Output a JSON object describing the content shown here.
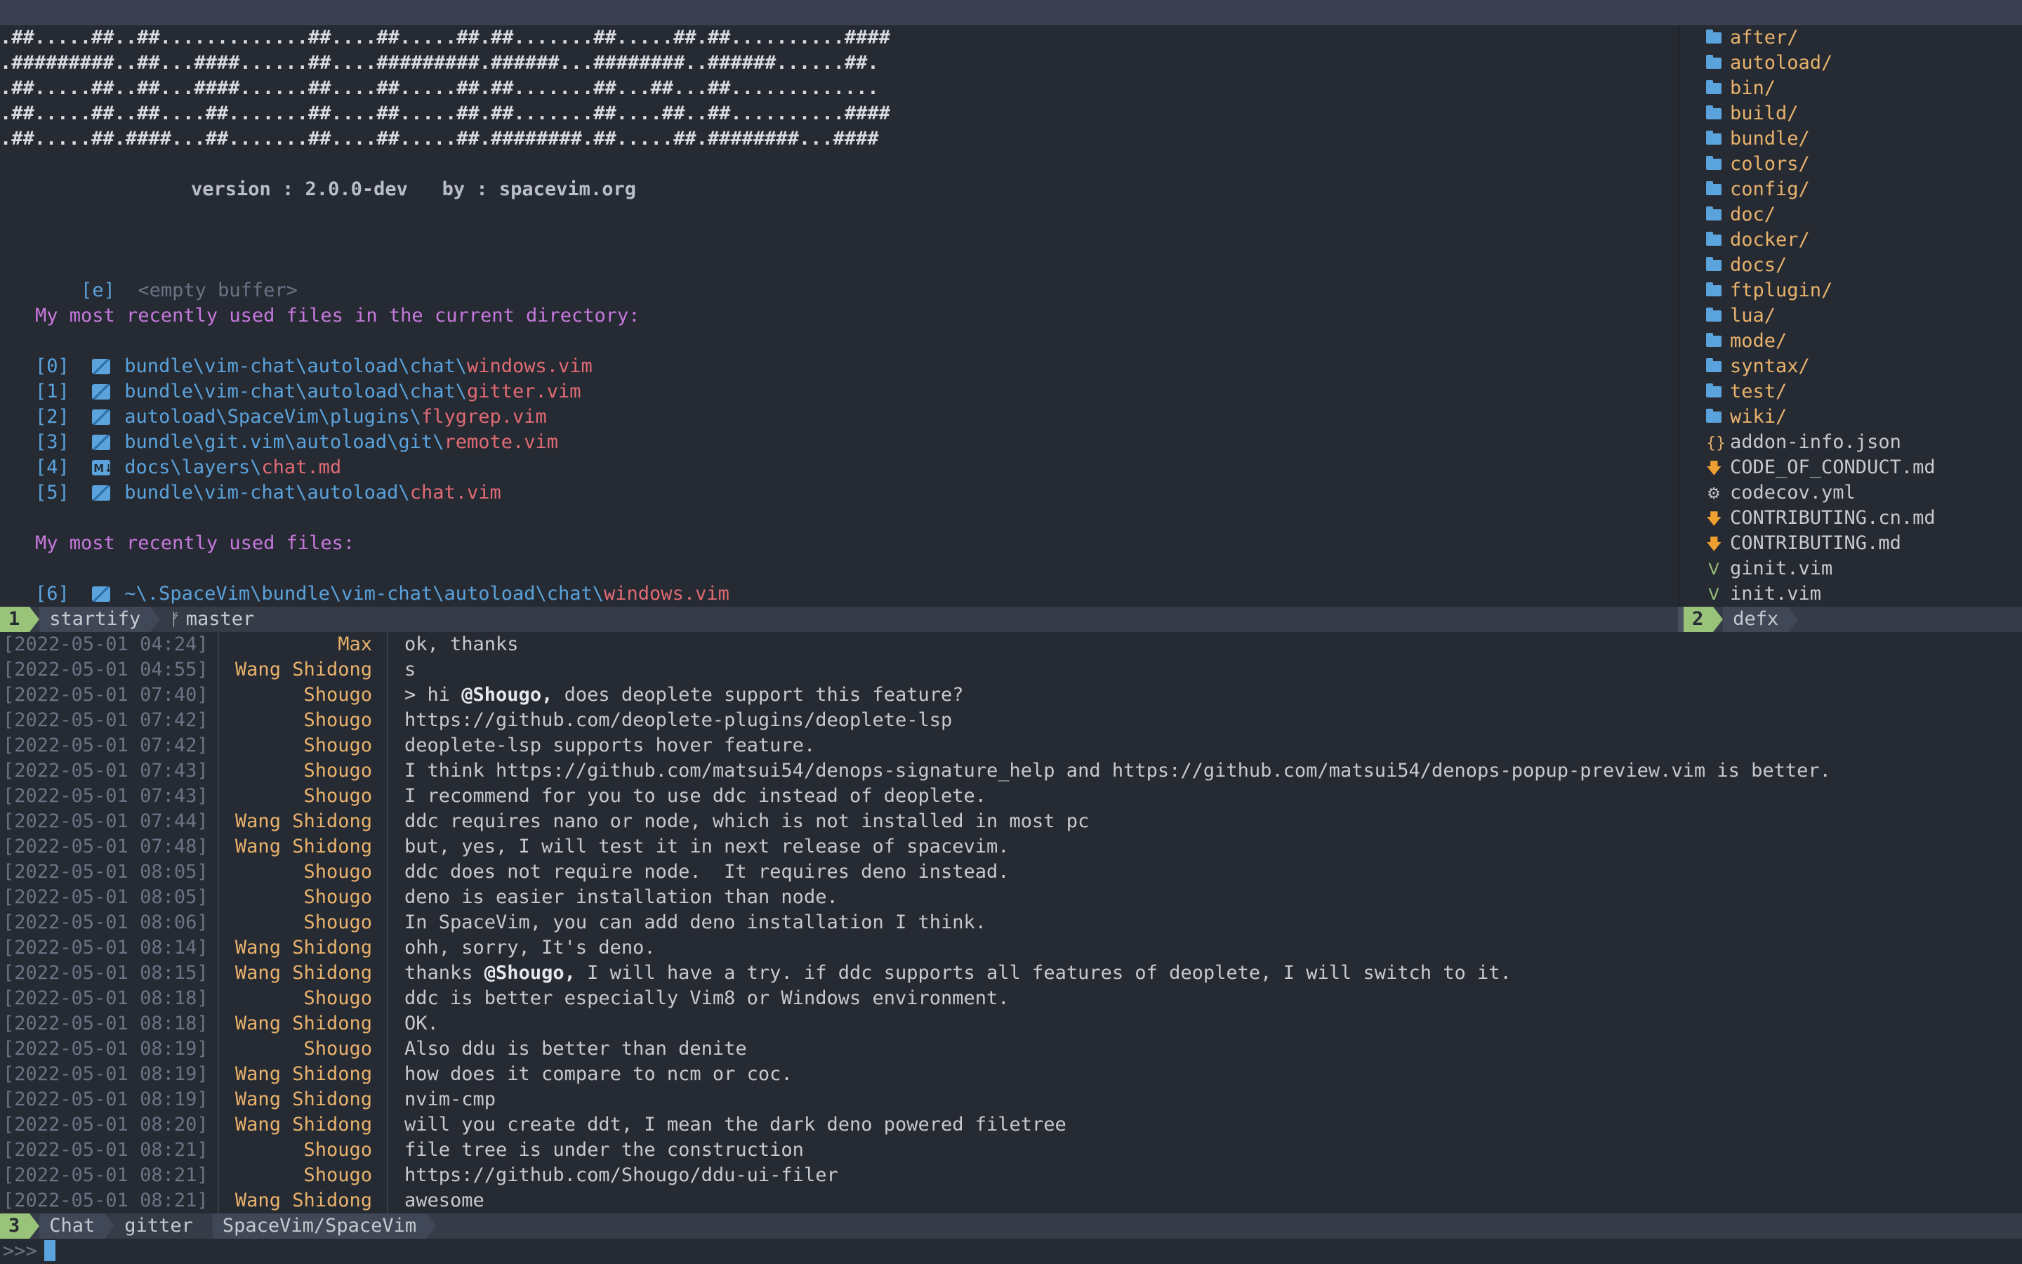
{
  "banner": [
    ".##.....##..##.............##....##.....##.##.......##.....##.##..........####",
    ".#########..##...####......##....#########.######...########..######......##.",
    ".##.....##..##...####......##....##.....##.##.......##...##...##.............",
    ".##.....##..##....##.......##....##.....##.##.......##....##..##..........####",
    ".##.....##.####...##.......##....##.....##.########.##.....##.########...####"
  ],
  "version_line": "version : 2.0.0-dev   by : spacevim.org",
  "empty_buffer": {
    "key": "[e]",
    "label": "<empty buffer>"
  },
  "section_cwd": "My most recently used files in the current directory:",
  "cwd_files": [
    {
      "idx": "[0]",
      "icon": "vim-file-icon",
      "path": "bundle\\vim-chat\\autoload\\chat\\",
      "name": "windows.vim"
    },
    {
      "idx": "[1]",
      "icon": "vim-file-icon",
      "path": "bundle\\vim-chat\\autoload\\chat\\",
      "name": "gitter.vim"
    },
    {
      "idx": "[2]",
      "icon": "vim-file-icon",
      "path": "autoload\\SpaceVim\\plugins\\",
      "name": "flygrep.vim"
    },
    {
      "idx": "[3]",
      "icon": "vim-file-icon",
      "path": "bundle\\git.vim\\autoload\\git\\",
      "name": "remote.vim"
    },
    {
      "idx": "[4]",
      "icon": "markdown-file-icon",
      "path": "docs\\layers\\",
      "name": "chat.md"
    },
    {
      "idx": "[5]",
      "icon": "vim-file-icon",
      "path": "bundle\\vim-chat\\autoload\\",
      "name": "chat.vim"
    }
  ],
  "section_all": "My most recently used files:",
  "all_files": [
    {
      "idx": "[6]",
      "icon": "vim-file-icon",
      "path": "~\\.SpaceVim\\bundle\\vim-chat\\autoload\\chat\\",
      "name": "windows.vim"
    }
  ],
  "defx": {
    "entries": [
      {
        "name": "after/",
        "type": "dir"
      },
      {
        "name": "autoload/",
        "type": "dir"
      },
      {
        "name": "bin/",
        "type": "dir"
      },
      {
        "name": "build/",
        "type": "dir"
      },
      {
        "name": "bundle/",
        "type": "dir"
      },
      {
        "name": "colors/",
        "type": "dir"
      },
      {
        "name": "config/",
        "type": "dir"
      },
      {
        "name": "doc/",
        "type": "dir"
      },
      {
        "name": "docker/",
        "type": "dir"
      },
      {
        "name": "docs/",
        "type": "dir"
      },
      {
        "name": "ftplugin/",
        "type": "dir"
      },
      {
        "name": "lua/",
        "type": "dir"
      },
      {
        "name": "mode/",
        "type": "dir"
      },
      {
        "name": "syntax/",
        "type": "dir"
      },
      {
        "name": "test/",
        "type": "dir"
      },
      {
        "name": "wiki/",
        "type": "dir"
      },
      {
        "name": "addon-info.json",
        "type": "file",
        "icon": "json-icon",
        "glyph": "{}",
        "color": "#e8b26c"
      },
      {
        "name": "CODE_OF_CONDUCT.md",
        "type": "file",
        "icon": "markdown-icon",
        "glyph": "🡇",
        "color": "#f0a030"
      },
      {
        "name": "codecov.yml",
        "type": "file",
        "icon": "gear-icon",
        "glyph": "⚙",
        "color": "#c6c9cf"
      },
      {
        "name": "CONTRIBUTING.cn.md",
        "type": "file",
        "icon": "markdown-icon",
        "glyph": "🡇",
        "color": "#f0a030"
      },
      {
        "name": "CONTRIBUTING.md",
        "type": "file",
        "icon": "markdown-icon",
        "glyph": "🡇",
        "color": "#f0a030"
      },
      {
        "name": "ginit.vim",
        "type": "file",
        "icon": "vim-icon",
        "glyph": "V",
        "color": "#98c379"
      },
      {
        "name": "init.vim",
        "type": "file",
        "icon": "vim-icon",
        "glyph": "V",
        "color": "#98c379"
      }
    ]
  },
  "status_top": {
    "win": "1",
    "name": "startify",
    "branch": "master"
  },
  "status_defx": {
    "win": "2",
    "name": "defx"
  },
  "chat": {
    "messages": [
      {
        "ts": "[2022-05-01 04:24]",
        "nick": "Max",
        "text": "ok, thanks"
      },
      {
        "ts": "[2022-05-01 04:55]",
        "nick": "Wang Shidong",
        "text": "s"
      },
      {
        "ts": "[2022-05-01 07:40]",
        "nick": "Shougo",
        "pre": "> hi ",
        "mention": "@Shougo,",
        "text": " does deoplete support this feature?"
      },
      {
        "ts": "[2022-05-01 07:42]",
        "nick": "Shougo",
        "text": "https://github.com/deoplete-plugins/deoplete-lsp"
      },
      {
        "ts": "[2022-05-01 07:42]",
        "nick": "Shougo",
        "text": "deoplete-lsp supports hover feature."
      },
      {
        "ts": "[2022-05-01 07:43]",
        "nick": "Shougo",
        "text": "I think https://github.com/matsui54/denops-signature_help and https://github.com/matsui54/denops-popup-preview.vim is better."
      },
      {
        "ts": "[2022-05-01 07:43]",
        "nick": "Shougo",
        "text": "I recommend for you to use ddc instead of deoplete."
      },
      {
        "ts": "[2022-05-01 07:44]",
        "nick": "Wang Shidong",
        "text": "ddc requires nano or node, which is not installed in most pc"
      },
      {
        "ts": "[2022-05-01 07:48]",
        "nick": "Wang Shidong",
        "text": "but, yes, I will test it in next release of spacevim."
      },
      {
        "ts": "[2022-05-01 08:05]",
        "nick": "Shougo",
        "text": "ddc does not require node.  It requires deno instead."
      },
      {
        "ts": "[2022-05-01 08:05]",
        "nick": "Shougo",
        "text": "deno is easier installation than node."
      },
      {
        "ts": "[2022-05-01 08:06]",
        "nick": "Shougo",
        "text": "In SpaceVim, you can add deno installation I think."
      },
      {
        "ts": "[2022-05-01 08:14]",
        "nick": "Wang Shidong",
        "text": "ohh, sorry, It's deno."
      },
      {
        "ts": "[2022-05-01 08:15]",
        "nick": "Wang Shidong",
        "pre": "thanks ",
        "mention": "@Shougo,",
        "text": " I will have a try. if ddc supports all features of deoplete, I will switch to it."
      },
      {
        "ts": "[2022-05-01 08:18]",
        "nick": "Shougo",
        "text": "ddc is better especially Vim8 or Windows environment."
      },
      {
        "ts": "[2022-05-01 08:18]",
        "nick": "Wang Shidong",
        "text": "OK."
      },
      {
        "ts": "[2022-05-01 08:19]",
        "nick": "Shougo",
        "text": "Also ddu is better than denite"
      },
      {
        "ts": "[2022-05-01 08:19]",
        "nick": "Wang Shidong",
        "text": "how does it compare to ncm or coc."
      },
      {
        "ts": "[2022-05-01 08:19]",
        "nick": "Wang Shidong",
        "text": "nvim-cmp"
      },
      {
        "ts": "[2022-05-01 08:20]",
        "nick": "Wang Shidong",
        "text": "will you create ddt, I mean the dark deno powered filetree"
      },
      {
        "ts": "[2022-05-01 08:21]",
        "nick": "Shougo",
        "text": "file tree is under the construction"
      },
      {
        "ts": "[2022-05-01 08:21]",
        "nick": "Shougo",
        "text": "https://github.com/Shougo/ddu-ui-filer"
      },
      {
        "ts": "[2022-05-01 08:21]",
        "nick": "Wang Shidong",
        "text": "awesome"
      }
    ]
  },
  "status_chat": {
    "win": "3",
    "name": "Chat",
    "provider": "gitter",
    "room": "SpaceVim/SpaceVim"
  },
  "prompt": ">>>"
}
